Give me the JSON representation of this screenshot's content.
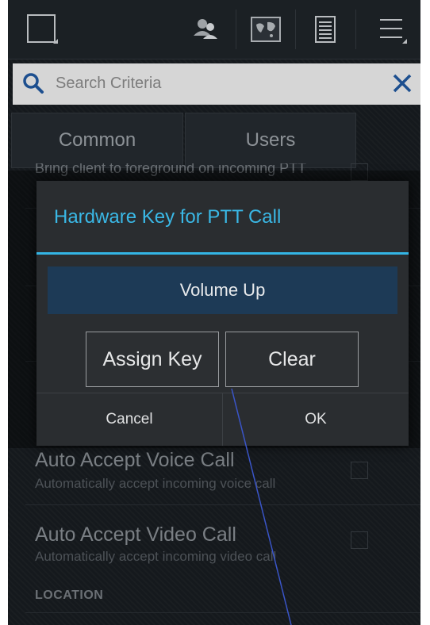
{
  "topbar": {
    "icons": [
      "window-icon",
      "contacts-icon",
      "map-icon",
      "list-icon",
      "menu-icon"
    ]
  },
  "search": {
    "placeholder": "Search Criteria"
  },
  "tabs": [
    {
      "label": "Common"
    },
    {
      "label": "Users"
    }
  ],
  "background_list": {
    "partial_item": "Bring client to foreground on incoming PTT",
    "items": [
      {
        "title": "Auto Accept Voice Call",
        "subtitle": "Automatically accept incoming voice call"
      },
      {
        "title": "Auto Accept Video Call",
        "subtitle": "Automatically accept incoming video call"
      }
    ],
    "section_header": "LOCATION"
  },
  "dialog": {
    "title": "Hardware Key for PTT Call",
    "current_key": "Volume Up",
    "assign_label": "Assign Key",
    "clear_label": "Clear",
    "cancel_label": "Cancel",
    "ok_label": "OK"
  },
  "colors": {
    "accent": "#33b5e5",
    "key_box": "#1d3a56",
    "annotation": "#3a55c8"
  }
}
